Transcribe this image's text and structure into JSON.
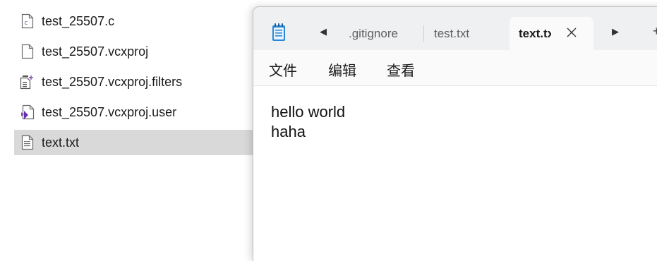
{
  "explorer": {
    "files": [
      {
        "name": "test_25507.c",
        "icon": "c-source-file-icon",
        "selected": false
      },
      {
        "name": "test_25507.vcxproj",
        "icon": "blank-file-icon",
        "selected": false
      },
      {
        "name": "test_25507.vcxproj.filters",
        "icon": "filters-file-icon",
        "selected": false
      },
      {
        "name": "test_25507.vcxproj.user",
        "icon": "visual-studio-file-icon",
        "selected": false
      },
      {
        "name": "text.txt",
        "icon": "text-file-icon",
        "selected": true
      }
    ]
  },
  "notepad": {
    "app_icon": "notepad-icon",
    "tabs": [
      {
        "label": ".gitignore",
        "active": false
      },
      {
        "label": "test.txt",
        "active": false
      },
      {
        "label": "text.txt",
        "active": true
      }
    ],
    "menu": {
      "file": "文件",
      "edit": "编辑",
      "view": "查看"
    },
    "editor_lines": [
      "hello world",
      "haha"
    ]
  }
}
